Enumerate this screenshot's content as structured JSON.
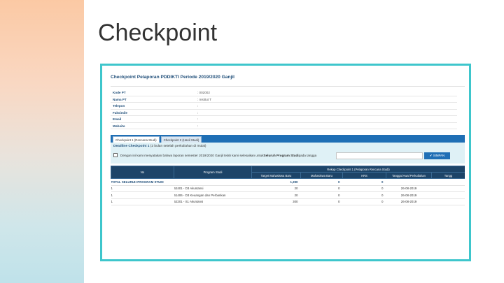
{
  "slide_title": "Checkpoint",
  "panel": {
    "title": "Checkpoint Pelaporan PDDIKTI Periode 2019/2020 Ganjil",
    "info": [
      {
        "label": "Kode PT",
        "value": ": 002002"
      },
      {
        "label": "Nama PT",
        "value": ": Institut T"
      },
      {
        "label": "Telepon",
        "value": ":"
      },
      {
        "label": "Faksimile",
        "value": ":"
      },
      {
        "label": "Email",
        "value": ":"
      },
      {
        "label": "Website",
        "value": ":"
      }
    ],
    "tabs": [
      "Checkpoint 1 (Rencana Studi)",
      "Checkpoint 2 (Hasil Studi)"
    ],
    "deadline_label": "Deadline Checkpoint 1",
    "deadline_note": "(2 bulan setelah perkuliahan di mulai)",
    "statement_prefix": "Dengan ini kami menyatakan bahwa laporan semester 2019/2020 Ganjil telah kami selesaikan untuk ",
    "statement_bold": "Seluruh Program Studi",
    "statement_suffix": " pada tangga",
    "date_input_value": "",
    "save_label": "✔ SIMPAN"
  },
  "table": {
    "headers": {
      "no": "No",
      "program": "Program Studi",
      "group": "Rekap Checkpoint 1 (Pelaporan Rencana Studi)",
      "target": "Target Mahasiswa Baru",
      "mhs_baru": "Mahasiswa Baru",
      "krs": "KRS",
      "tanggal": "Tanggal Awal Perkuliahan",
      "extra": "Tangg"
    },
    "total_label": "TOTAL SELURUH PROGRAM STUDI",
    "total_target": "1,390",
    "total_mhs": "0",
    "total_krs": "0",
    "rows": [
      {
        "no": "1",
        "program": "62401 - D3 Akuntansi",
        "target": "20",
        "mhs_baru": "0",
        "krs": "0",
        "tanggal": "26-08-2019"
      },
      {
        "no": "1",
        "program": "61406 - D3 Keuangan dan Perbankan",
        "target": "20",
        "mhs_baru": "0",
        "krs": "0",
        "tanggal": "26-08-2019"
      },
      {
        "no": "1",
        "program": "62201 - S1 Akuntansi",
        "target": "300",
        "mhs_baru": "0",
        "krs": "0",
        "tanggal": "26-08-2019"
      }
    ]
  },
  "colors": {
    "frame": "#3ec6cc",
    "header_blue": "#1d4468",
    "tab_bar": "#1f6fb5"
  }
}
